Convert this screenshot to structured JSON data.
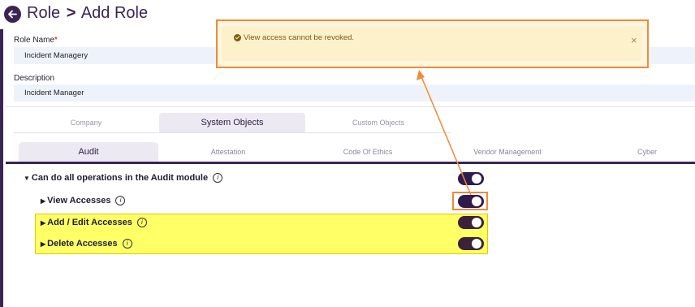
{
  "header": {
    "breadcrumb_parent": "Role",
    "separator": ">",
    "title": "Add Role"
  },
  "form": {
    "role_name_label": "Role Name",
    "required_mark": "*",
    "role_name_value": "Incident Managery",
    "description_label": "Description",
    "description_value": "Incident Manager"
  },
  "object_tabs": [
    "Company",
    "System Objects",
    "Custom Objects"
  ],
  "module_tabs": [
    "Audit",
    "Attestation",
    "Code Of Ethics",
    "Vendor Management",
    "Cyber"
  ],
  "permissions": {
    "all_ops": "Can do all operations in the Audit module",
    "view": "View Accesses",
    "add_edit": "Add / Edit Accesses",
    "delete": "Delete Accesses",
    "info_glyph": "i"
  },
  "toast": {
    "message": "View access cannot be revoked.",
    "close": "×"
  },
  "colors": {
    "accent": "#3a2456",
    "highlight": "#ffff66",
    "annotation": "#f08a34",
    "toast_bg": "#fdf1cc"
  }
}
